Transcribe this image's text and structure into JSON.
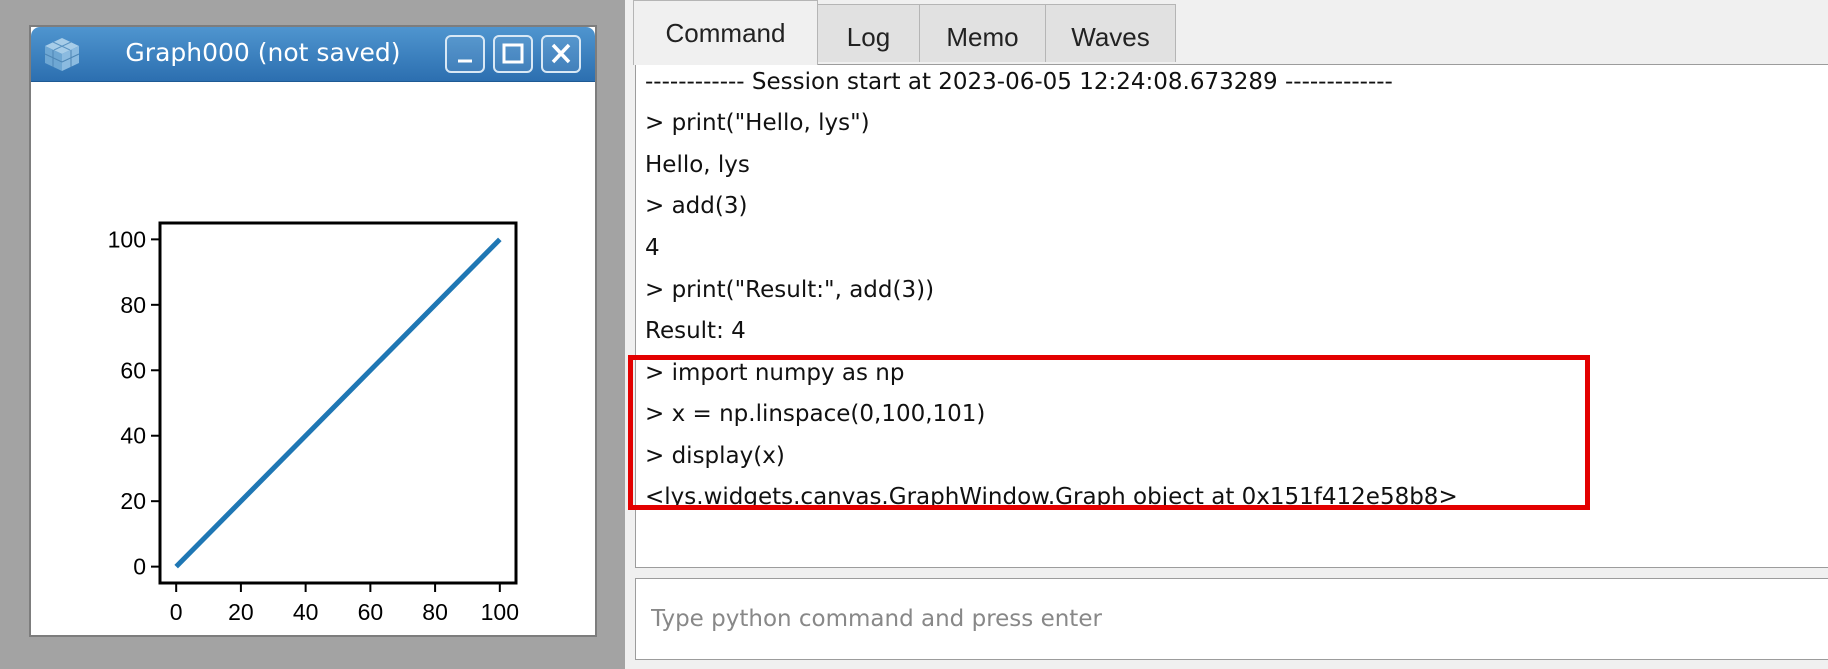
{
  "graph_window": {
    "title": "Graph000 (not saved)",
    "buttons": {
      "minimize_icon": "minimize-icon",
      "maximize_icon": "maximize-icon",
      "close_icon": "close-icon"
    }
  },
  "chart_data": {
    "type": "line",
    "x": [
      0,
      100
    ],
    "series": [
      {
        "values": [
          0,
          100
        ],
        "color": "#1f77b4"
      }
    ],
    "xticks": [
      "0",
      "20",
      "40",
      "60",
      "80",
      "100"
    ],
    "yticks": [
      "0",
      "20",
      "40",
      "60",
      "80",
      "100"
    ],
    "xlim": [
      -5,
      105
    ],
    "ylim": [
      -5,
      105
    ],
    "grid": false,
    "title": "",
    "xlabel": "",
    "ylabel": ""
  },
  "console": {
    "tabs": [
      "Command",
      "Log",
      "Memo",
      "Waves"
    ],
    "active_tab": "Command",
    "lines": [
      "------------ Session start at 2023-06-05 12:24:08.673289 -------------",
      "> print(\"Hello, lys\")",
      "Hello, lys",
      "> add(3)",
      "4",
      "> print(\"Result:\", add(3))",
      "Result: 4",
      "> import numpy as np",
      "> x = np.linspace(0,100,101)",
      "> display(x)",
      "<lys.widgets.canvas.GraphWindow.Graph object at 0x151f412e58b8>"
    ],
    "input_placeholder": "Type python command and press enter",
    "highlight_color": "#e30000"
  }
}
